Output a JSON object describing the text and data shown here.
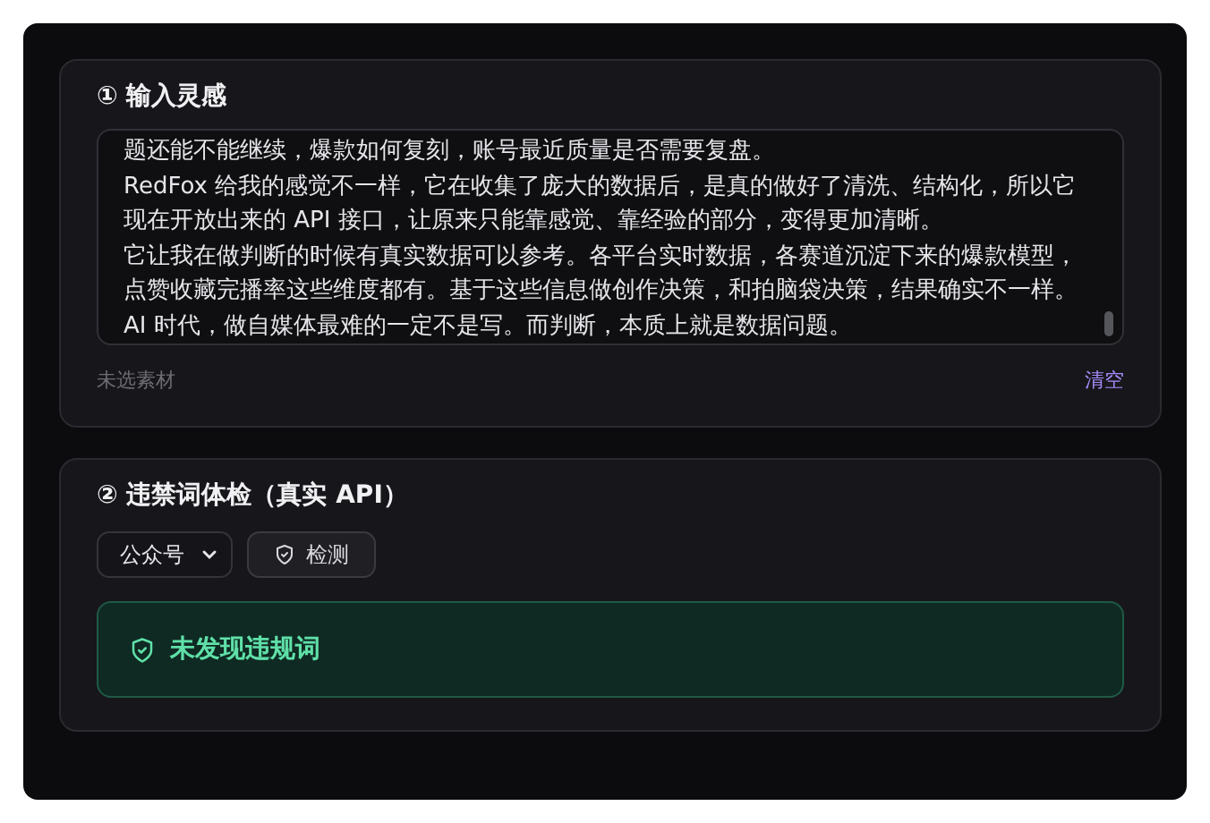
{
  "inspiration": {
    "title": "① 输入灵感",
    "text_lines": [
      "题还能不能继续，爆款如何复刻，账号最近质量是否需要复盘。",
      "RedFox 给我的感觉不一样，它在收集了庞大的数据后，是真的做好了清洗、结构化，所以它",
      "现在开放出来的 API 接口，让原来只能靠感觉、靠经验的部分，变得更加清晰。",
      "它让我在做判断的时候有真实数据可以参考。各平台实时数据，各赛道沉淀下来的爆款模型，",
      "点赞收藏完播率这些维度都有。基于这些信息做创作决策，和拍脑袋决策，结果确实不一样。",
      "AI 时代，做自媒体最难的一定不是写。而判断，本质上就是数据问题。"
    ],
    "status": "未选素材",
    "clear_button": "清空"
  },
  "check": {
    "title": "② 违禁词体检（真实 API）",
    "platform": "公众号",
    "check_button": "检测",
    "result": {
      "kind": "ok",
      "text": "未发现违规词"
    }
  }
}
